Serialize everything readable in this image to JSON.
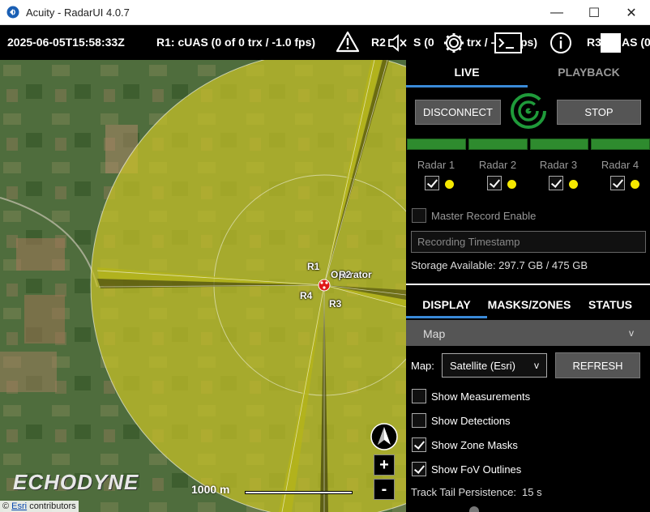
{
  "window": {
    "title": "Acuity - RadarUI 4.0.7",
    "minimize": "—",
    "maximize": "☐",
    "close": "✕"
  },
  "statusbar": {
    "timestamp": "2025-06-05T15:58:33Z",
    "r1_status": "R1: cUAS  (0 of 0 trx / -1.0 fps)",
    "r2_prefix": "R2",
    "r2_suffix": "S  (0",
    "trx_suffix": "trx / -",
    "fps_suffix": "ps)",
    "r3_prefix": "R3",
    "r3_suffix": "AS  (0"
  },
  "map": {
    "radar_labels": [
      "R1",
      "R2",
      "R3",
      "R4"
    ],
    "operator_label": "Operator",
    "scale_label": "1000 m",
    "brand_logo": "ECHODYNE",
    "zoom_in": "+",
    "zoom_out": "-",
    "attribution_prefix": "©",
    "attribution_link": "Esri",
    "attribution_suffix": "contributors",
    "colors": {
      "coverage": "#c8c227",
      "fov_wedge": "#b4b41a"
    }
  },
  "panel": {
    "tab_live": "LIVE",
    "tab_playback": "PLAYBACK",
    "disconnect": "DISCONNECT",
    "stop": "STOP",
    "radars": [
      {
        "label": "Radar 1"
      },
      {
        "label": "Radar 2"
      },
      {
        "label": "Radar 3"
      },
      {
        "label": "Radar 4"
      }
    ],
    "master_record": "Master Record Enable",
    "recording_placeholder": "Recording Timestamp",
    "storage": "Storage Available: 297.7 GB / 475 GB",
    "tab_display": "DISPLAY",
    "tab_masks": "MASKS/ZONES",
    "tab_status": "STATUS",
    "section_map": "Map",
    "section_chevron": "v",
    "map_label": "Map:",
    "map_select": "Satellite (Esri)",
    "map_select_chevron": "v",
    "refresh": "REFRESH",
    "options": [
      {
        "label": "Show Measurements",
        "checked": false
      },
      {
        "label": "Show Detections",
        "checked": false
      },
      {
        "label": "Show Zone Masks",
        "checked": true
      },
      {
        "label": "Show FoV Outlines",
        "checked": true
      }
    ],
    "track_tail_label": "Track Tail Persistence:",
    "track_tail_value": "15 s"
  }
}
